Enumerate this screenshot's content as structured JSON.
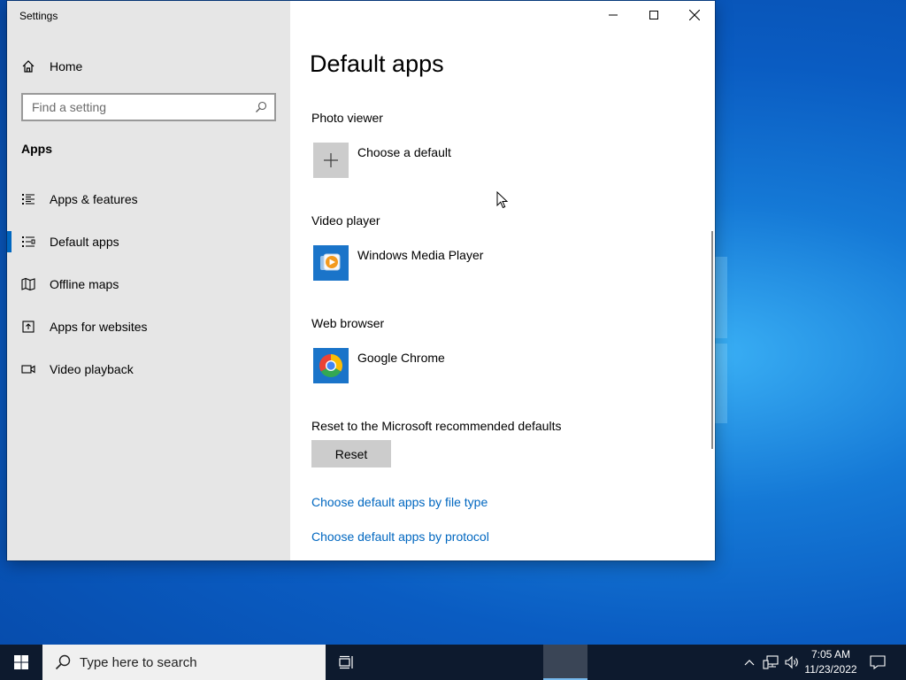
{
  "window": {
    "title": "Settings"
  },
  "sidebar": {
    "home_label": "Home",
    "search_placeholder": "Find a setting",
    "section_heading": "Apps",
    "items": [
      {
        "label": "Apps & features",
        "icon": "list-icon"
      },
      {
        "label": "Default apps",
        "icon": "default-apps-icon",
        "selected": true
      },
      {
        "label": "Offline maps",
        "icon": "map-icon"
      },
      {
        "label": "Apps for websites",
        "icon": "open-in-new-icon"
      },
      {
        "label": "Video playback",
        "icon": "video-camera-icon"
      }
    ]
  },
  "main": {
    "title": "Default apps",
    "groups": [
      {
        "label": "Photo viewer",
        "app": "Choose a default",
        "icon": "plus-icon"
      },
      {
        "label": "Video player",
        "app": "Windows Media Player",
        "icon": "windows-media-player-icon"
      },
      {
        "label": "Web browser",
        "app": "Google Chrome",
        "icon": "chrome-icon"
      }
    ],
    "reset_label": "Reset to the Microsoft recommended defaults",
    "reset_button": "Reset",
    "links": [
      "Choose default apps by file type",
      "Choose default apps by protocol"
    ]
  },
  "taskbar": {
    "search_placeholder": "Type here to search",
    "time": "7:05 AM",
    "date": "11/23/2022"
  },
  "colors": {
    "accent": "#0067c0",
    "sidebar_bg": "#e6e6e6",
    "taskbar_bg": "#0d1a2e"
  }
}
